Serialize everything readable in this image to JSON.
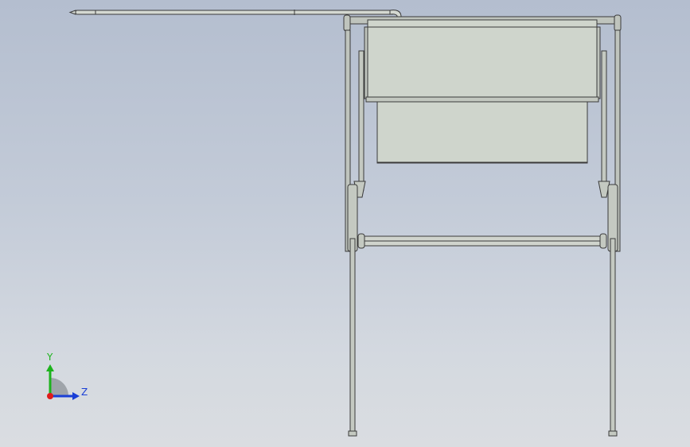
{
  "viewport": {
    "background_top": "#b4becf",
    "background_bottom": "#dadde1",
    "model_line_color": "#3a3a3a",
    "panel_fill": "#cfd5cc",
    "frame_fill": "#bfc4bd"
  },
  "triad": {
    "y_label": "Y",
    "z_label": "Z",
    "y_color": "#1db31d",
    "z_color": "#1a3fd6",
    "x_color": "#e01b1b",
    "y_icon": "axis-y-arrow-icon",
    "z_icon": "axis-z-arrow-icon",
    "origin_icon": "axis-origin-icon"
  }
}
